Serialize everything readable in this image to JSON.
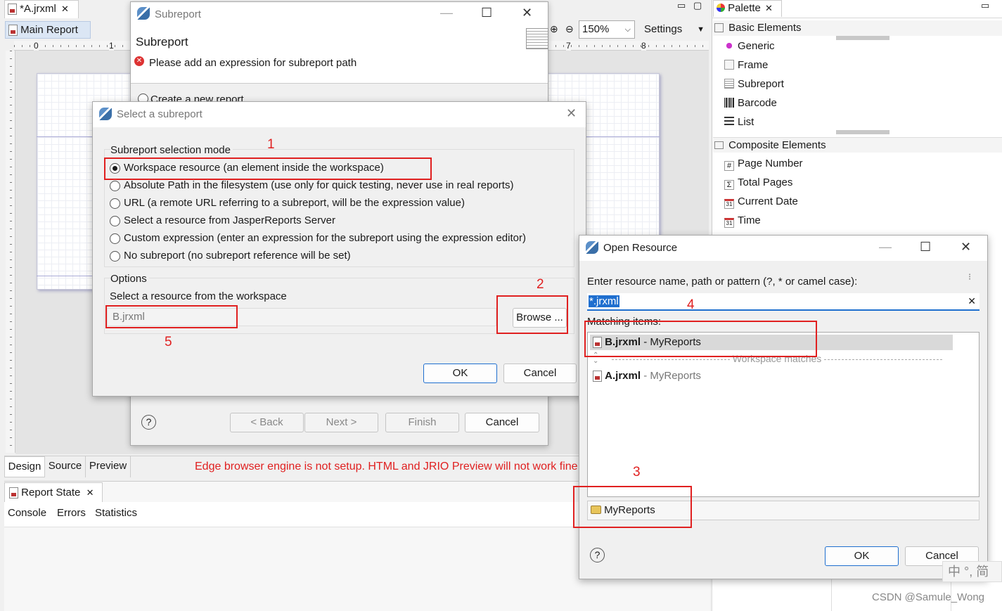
{
  "editor": {
    "file_tab": "*A.jrxml",
    "main_report_tab": "Main Report",
    "zoom": "150%",
    "settings": "Settings",
    "ruler_marks": [
      "0",
      "1",
      "7",
      "8"
    ],
    "bottom_tabs": [
      "Design",
      "Source",
      "Preview"
    ],
    "warning": "Edge browser engine is not setup. HTML and JRIO Preview will not work fine"
  },
  "report_state": {
    "tab": "Report State",
    "subtabs": [
      "Console",
      "Errors",
      "Statistics"
    ]
  },
  "palette": {
    "tab": "Palette",
    "basic_header": "Basic Elements",
    "basic_items": [
      "Generic",
      "Frame",
      "Subreport",
      "Barcode",
      "List"
    ],
    "composite_header": "Composite Elements",
    "composite_items": [
      "Page Number",
      "Total Pages",
      "Current Date",
      "Time"
    ]
  },
  "subreport_wizard": {
    "title": "Subreport",
    "heading": "Subreport",
    "error": "Please add an expression for subreport path",
    "partial_option": "Create a new report",
    "back": "< Back",
    "next": "Next >",
    "finish": "Finish",
    "cancel": "Cancel"
  },
  "select_dialog": {
    "title": "Select a subreport",
    "mode_label": "Subreport selection mode",
    "modes": [
      "Workspace resource (an element inside the workspace)",
      "Absolute Path in the filesystem (use only for quick testing, never use in real reports)",
      "URL (a remote URL referring to a subreport, will be the expression value)",
      "Select a resource from JasperReports Server",
      "Custom expression (enter an expression for the subreport using the expression editor)",
      "No subreport (no subreport reference will be set)"
    ],
    "options_label": "Options",
    "workspace_label": "Select a resource from the workspace",
    "path_value": "B.jrxml",
    "browse": "Browse ...",
    "ok": "OK",
    "cancel": "Cancel"
  },
  "open_resource": {
    "title": "Open Resource",
    "prompt": "Enter resource name, path or pattern (?, * or camel case):",
    "pattern": "*.jrxml",
    "matching_label": "Matching items:",
    "items": [
      {
        "name": "B.jrxml",
        "project": " - MyReports"
      },
      {
        "name": "A.jrxml",
        "project": " - MyReports"
      }
    ],
    "separator": "Workspace matches",
    "folder": "MyReports",
    "ok": "OK",
    "cancel": "Cancel"
  },
  "annotations": [
    "1",
    "2",
    "3",
    "4",
    "5"
  ],
  "ime": "中 °, 简",
  "watermark": "CSDN @Samule_Wong"
}
